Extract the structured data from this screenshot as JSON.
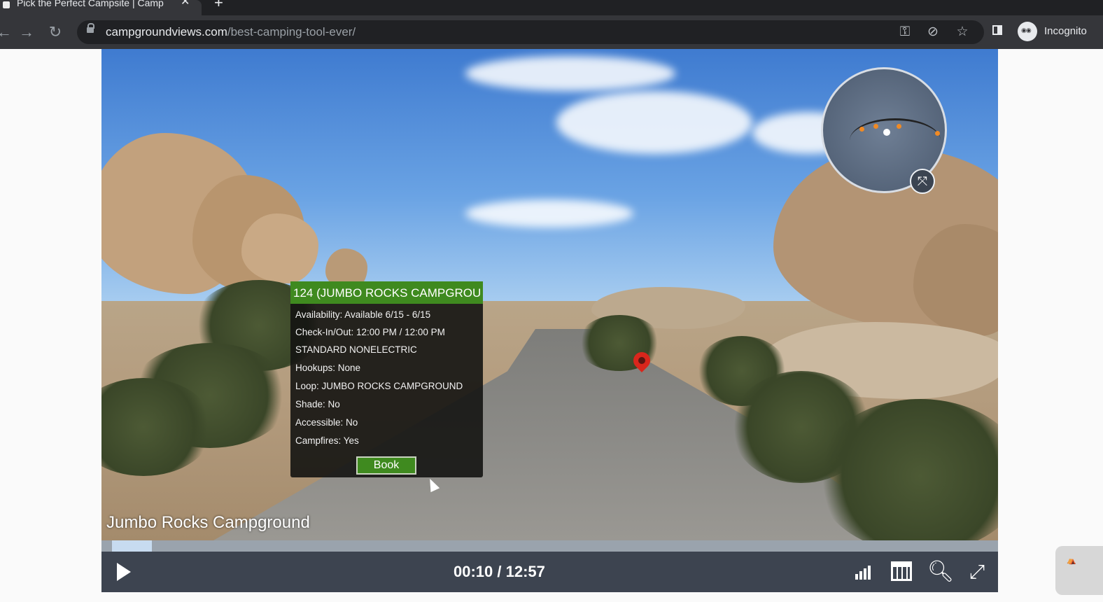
{
  "browser": {
    "tab_title": "Pick the Perfect Campsite | Camp",
    "url_host": "campgroundviews.com",
    "url_path": "/best-camping-tool-ever/",
    "profile_label": "Incognito"
  },
  "icons": {
    "back": "arrow-left-icon",
    "forward": "arrow-right-icon",
    "reload": "reload-icon",
    "key": "key-icon",
    "eye_off": "eye-off-icon",
    "star": "star-icon"
  },
  "popup": {
    "title": "124 (JUMBO ROCKS CAMPGROU",
    "lines": [
      "Availability: Available 6/15 - 6/15",
      "Check-In/Out: 12:00 PM / 12:00 PM",
      "STANDARD NONELECTRIC",
      "Hookups: None",
      "Loop: JUMBO ROCKS CAMPGROUND",
      "Shade: No",
      "Accessible: No",
      "Campfires: Yes"
    ],
    "book_label": "Book"
  },
  "video": {
    "caption": "Jumbo Rocks Campground",
    "timecode": "00:10 / 12:57",
    "progress_fraction": 0.056
  },
  "colors": {
    "popup_header": "#3f8a1f",
    "controls_bg": "#3d4450",
    "pin": "#d9261c"
  }
}
